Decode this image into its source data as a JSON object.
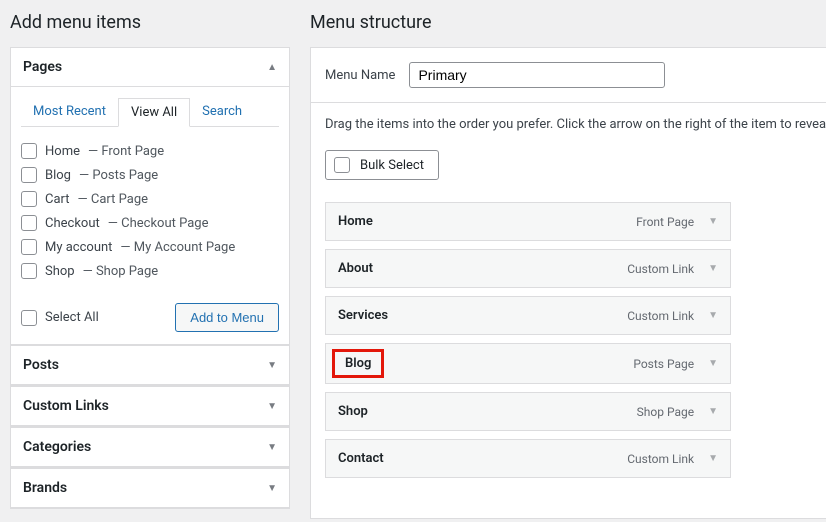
{
  "left": {
    "title": "Add menu items",
    "pages": {
      "title": "Pages"
    },
    "tabs": {
      "recent": "Most Recent",
      "view_all": "View All",
      "search": "Search"
    },
    "checklist": [
      {
        "name": "Home",
        "suffix": "— Front Page"
      },
      {
        "name": "Blog",
        "suffix": "— Posts Page"
      },
      {
        "name": "Cart",
        "suffix": "— Cart Page"
      },
      {
        "name": "Checkout",
        "suffix": "— Checkout Page"
      },
      {
        "name": "My account",
        "suffix": "— My Account Page"
      },
      {
        "name": "Shop",
        "suffix": "— Shop Page"
      }
    ],
    "select_all": "Select All",
    "add_btn": "Add to Menu",
    "collapsed": [
      {
        "title": "Posts"
      },
      {
        "title": "Custom Links"
      },
      {
        "title": "Categories"
      },
      {
        "title": "Brands"
      }
    ]
  },
  "right": {
    "title": "Menu structure",
    "menu_name_label": "Menu Name",
    "menu_name_value": "Primary",
    "instructions": "Drag the items into the order you prefer. Click the arrow on the right of the item to reveal additional configuration options.",
    "bulk_select": "Bulk Select",
    "items": [
      {
        "name": "Home",
        "type": "Front Page",
        "highlight": false
      },
      {
        "name": "About",
        "type": "Custom Link",
        "highlight": false
      },
      {
        "name": "Services",
        "type": "Custom Link",
        "highlight": false
      },
      {
        "name": "Blog",
        "type": "Posts Page",
        "highlight": true
      },
      {
        "name": "Shop",
        "type": "Shop Page",
        "highlight": false
      },
      {
        "name": "Contact",
        "type": "Custom Link",
        "highlight": false
      }
    ]
  }
}
